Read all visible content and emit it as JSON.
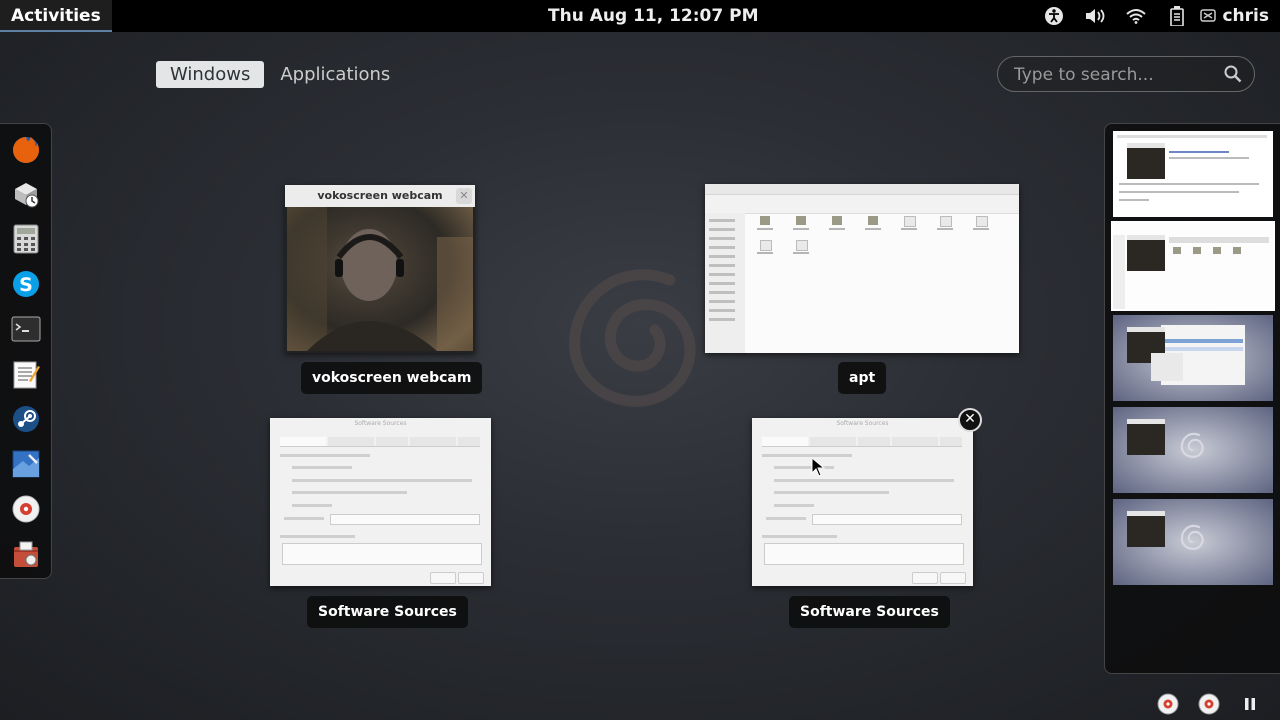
{
  "topbar": {
    "activities": "Activities",
    "clock": "Thu Aug 11, 12:07 PM",
    "user_name": "chris",
    "tray_icons": [
      "accessibility-icon",
      "volume-icon",
      "wifi-icon",
      "battery-icon"
    ]
  },
  "overview": {
    "tabs": [
      {
        "label": "Windows",
        "active": true
      },
      {
        "label": "Applications",
        "active": false
      }
    ],
    "search_placeholder": "Type to search..."
  },
  "dash": {
    "apps": [
      "firefox-icon",
      "software-update-icon",
      "calculator-icon",
      "skype-icon",
      "terminal-icon",
      "text-editor-icon",
      "steam-icon",
      "system-settings-icon",
      "vokoscreen-icon",
      "software-center-icon"
    ]
  },
  "windows": [
    {
      "label": "vokoscreen webcam",
      "title": "vokoscreen webcam"
    },
    {
      "label": "apt",
      "title": "apt"
    },
    {
      "label": "Software Sources",
      "title": "Software Sources"
    },
    {
      "label": "Software Sources",
      "title": "Software Sources"
    }
  ],
  "workspaces": {
    "count": 5,
    "active_index": 1
  },
  "colors": {
    "accent": "#5d7fa3",
    "background": "#2b2e34"
  }
}
